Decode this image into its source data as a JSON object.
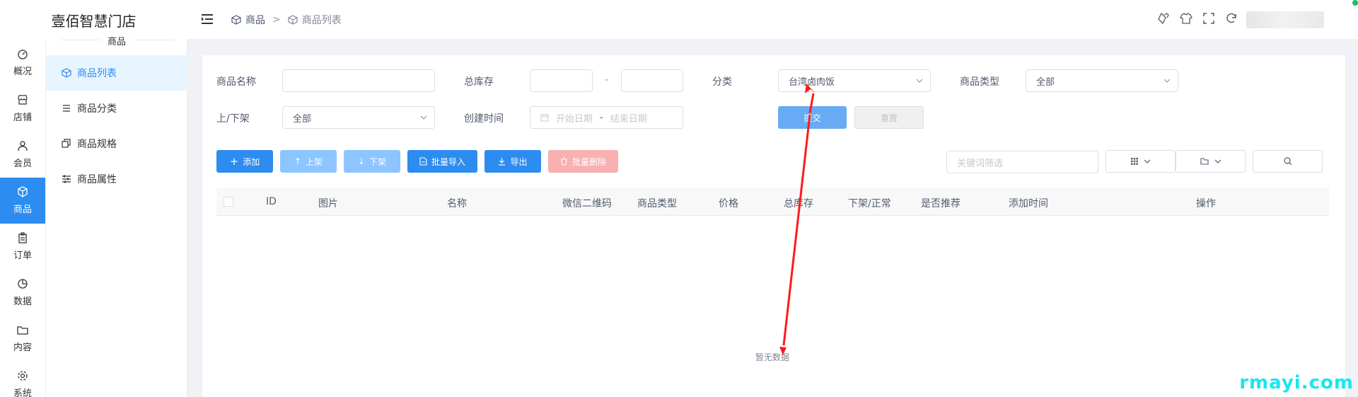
{
  "app": {
    "title": "壹佰智慧门店"
  },
  "rail": [
    {
      "label": "概况",
      "icon": "dashboard-icon",
      "active": false
    },
    {
      "label": "店铺",
      "icon": "store-icon",
      "active": false
    },
    {
      "label": "会员",
      "icon": "user-icon",
      "active": false
    },
    {
      "label": "商品",
      "icon": "cube-icon",
      "active": true
    },
    {
      "label": "订单",
      "icon": "clipboard-icon",
      "active": false
    },
    {
      "label": "数据",
      "icon": "pie-chart-icon",
      "active": false
    },
    {
      "label": "内容",
      "icon": "folder-icon",
      "active": false
    },
    {
      "label": "系统",
      "icon": "gear-icon",
      "active": false
    }
  ],
  "submenu": {
    "title": "商品",
    "items": [
      {
        "label": "商品列表",
        "icon": "cube-icon",
        "active": true
      },
      {
        "label": "商品分类",
        "icon": "list-icon",
        "active": false
      },
      {
        "label": "商品规格",
        "icon": "copy-icon",
        "active": false
      },
      {
        "label": "商品属性",
        "icon": "sliders-icon",
        "active": false
      }
    ]
  },
  "breadcrumb": {
    "root": "商品",
    "sep": ">",
    "current": "商品列表"
  },
  "filters": {
    "name_label": "商品名称",
    "stock_label": "总库存",
    "stock_dash": "-",
    "category_label": "分类",
    "category_value": "台湾卤肉饭",
    "type_label": "商品类型",
    "type_value": "全部",
    "shelf_label": "上/下架",
    "shelf_value": "全部",
    "created_label": "创建时间",
    "date_start_placeholder": "开始日期",
    "date_sep": "-",
    "date_end_placeholder": "结束日期",
    "submit": "提交",
    "reset": "重置"
  },
  "actions": {
    "add": "添加",
    "on_shelf": "上架",
    "off_shelf": "下架",
    "batch_import": "批量导入",
    "export": "导出",
    "batch_delete": "批量删除",
    "keyword_placeholder": "关键词筛选"
  },
  "table": {
    "columns": [
      "ID",
      "图片",
      "名称",
      "微信二维码",
      "商品类型",
      "价格",
      "总库存",
      "下架/正常",
      "是否推荐",
      "添加时间",
      "操作"
    ],
    "empty_text": "暂无数据"
  },
  "watermark": "rmayi.com",
  "colors": {
    "primary": "#2d8cf0",
    "annotation_arrow": "#ff1a1a"
  }
}
